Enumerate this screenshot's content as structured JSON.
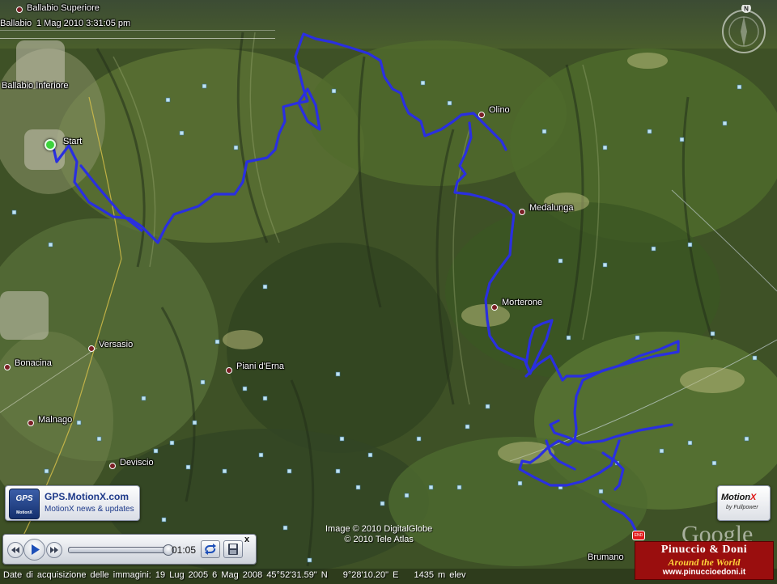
{
  "map": {
    "timestamp": "1 Mag 2010    3:31:05 pm",
    "start_label": "Start",
    "places": [
      {
        "id": "ballabio-superiore",
        "label": "Ballabio Superiore"
      },
      {
        "id": "ballabio",
        "label": "Ballabio"
      },
      {
        "id": "ballabio-inferiore",
        "label": "Ballabio Inferiore"
      },
      {
        "id": "olino",
        "label": "Olino"
      },
      {
        "id": "medalunga",
        "label": "Medalunga"
      },
      {
        "id": "morterone",
        "label": "Morterone"
      },
      {
        "id": "versasio",
        "label": "Versasio"
      },
      {
        "id": "piani-d-erna",
        "label": "Piani d'Erna"
      },
      {
        "id": "bonacina",
        "label": "Bonacina"
      },
      {
        "id": "malnago",
        "label": "Malnago"
      },
      {
        "id": "deviscio",
        "label": "Deviscio"
      },
      {
        "id": "brumano",
        "label": "Brumano"
      }
    ],
    "end_badge": "END",
    "compass_letter": "N",
    "colors": {
      "track": "#2a2fe0",
      "place_dot": "#7a1f25",
      "start": "#3cd33c"
    }
  },
  "promo": {
    "logo_text": "GPS",
    "logo_sub": "MotionX",
    "title": "GPS.MotionX.com",
    "subtitle": "MotionX news & updates"
  },
  "motionx_logo": {
    "name_a": "Motion",
    "name_b": "X",
    "tagline": "by Fullpower"
  },
  "player": {
    "time": "01:05",
    "progress": 0.98,
    "close": "x",
    "icons": [
      "rewind-icon",
      "play-icon",
      "fast-forward-icon",
      "loop-icon",
      "save-icon"
    ]
  },
  "copyright": {
    "line1": "Image © 2010 DigitalGlobe",
    "line2": "© 2010 Tele Atlas"
  },
  "google_logo": "Google",
  "status": {
    "imagery_date": "Date di acquisizione delle immagini: 19 Lug 2005 6 Mag 2008",
    "lat": "45°52'31.59\" N",
    "lon": "9°28'10.20\" E",
    "elev": "1435 m elev"
  },
  "watermark": {
    "line1": "Pinuccio & Doni",
    "line2": "Around the World",
    "line3": "www.pinuccioedoni.it"
  }
}
